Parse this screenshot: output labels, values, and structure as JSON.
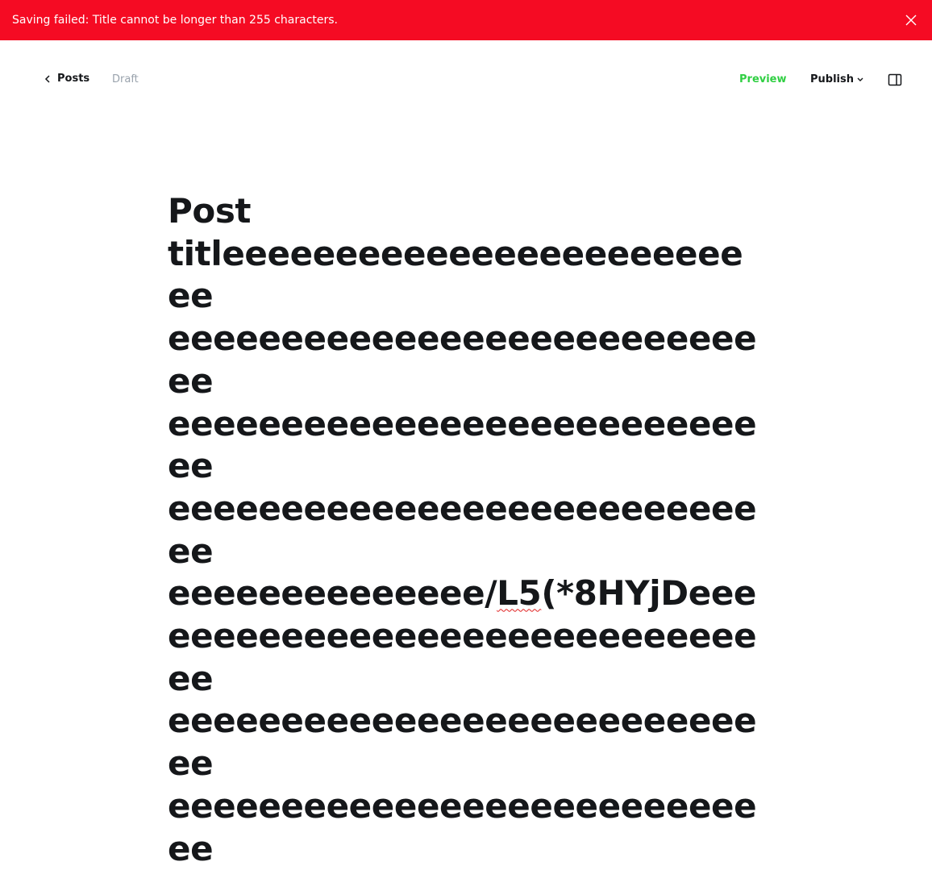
{
  "banner": {
    "message": "Saving failed: Title cannot be longer than 255 characters.",
    "close_icon": "close-icon",
    "background": "#f50b23"
  },
  "toolbar": {
    "back_label": "Posts",
    "back_icon": "chevron-left-icon",
    "status": "Draft",
    "preview_label": "Preview",
    "publish_label": "Publish",
    "publish_icon": "chevron-down-icon",
    "sidebar_icon": "sidebar-toggle-icon",
    "accent": "#30cf43"
  },
  "editor": {
    "title_lines": [
      "Post",
      "titleeeeeeeeeeeeeeeeeeeeeeeee",
      "eeeeeeeeeeeeeeeeeeeeeeeeeeee",
      "eeeeeeeeeeeeeeeeeeeeeeeeeeee",
      "eeeeeeeeeeeeeeeeeeeeeeeeeeee",
      "eeeeeeeeeeeeee/",
      "eeeeeeeeeeeeeeeeeeeeeeeeeeee",
      "eeeeeeeeeeeeeeeeeeeeeeeeeeee",
      "eeeeeeeeeeeeeeeeeeeeeeeeeeee"
    ],
    "misspelled_segment": "L5",
    "line6_tail": "(*8HYjDeee"
  }
}
